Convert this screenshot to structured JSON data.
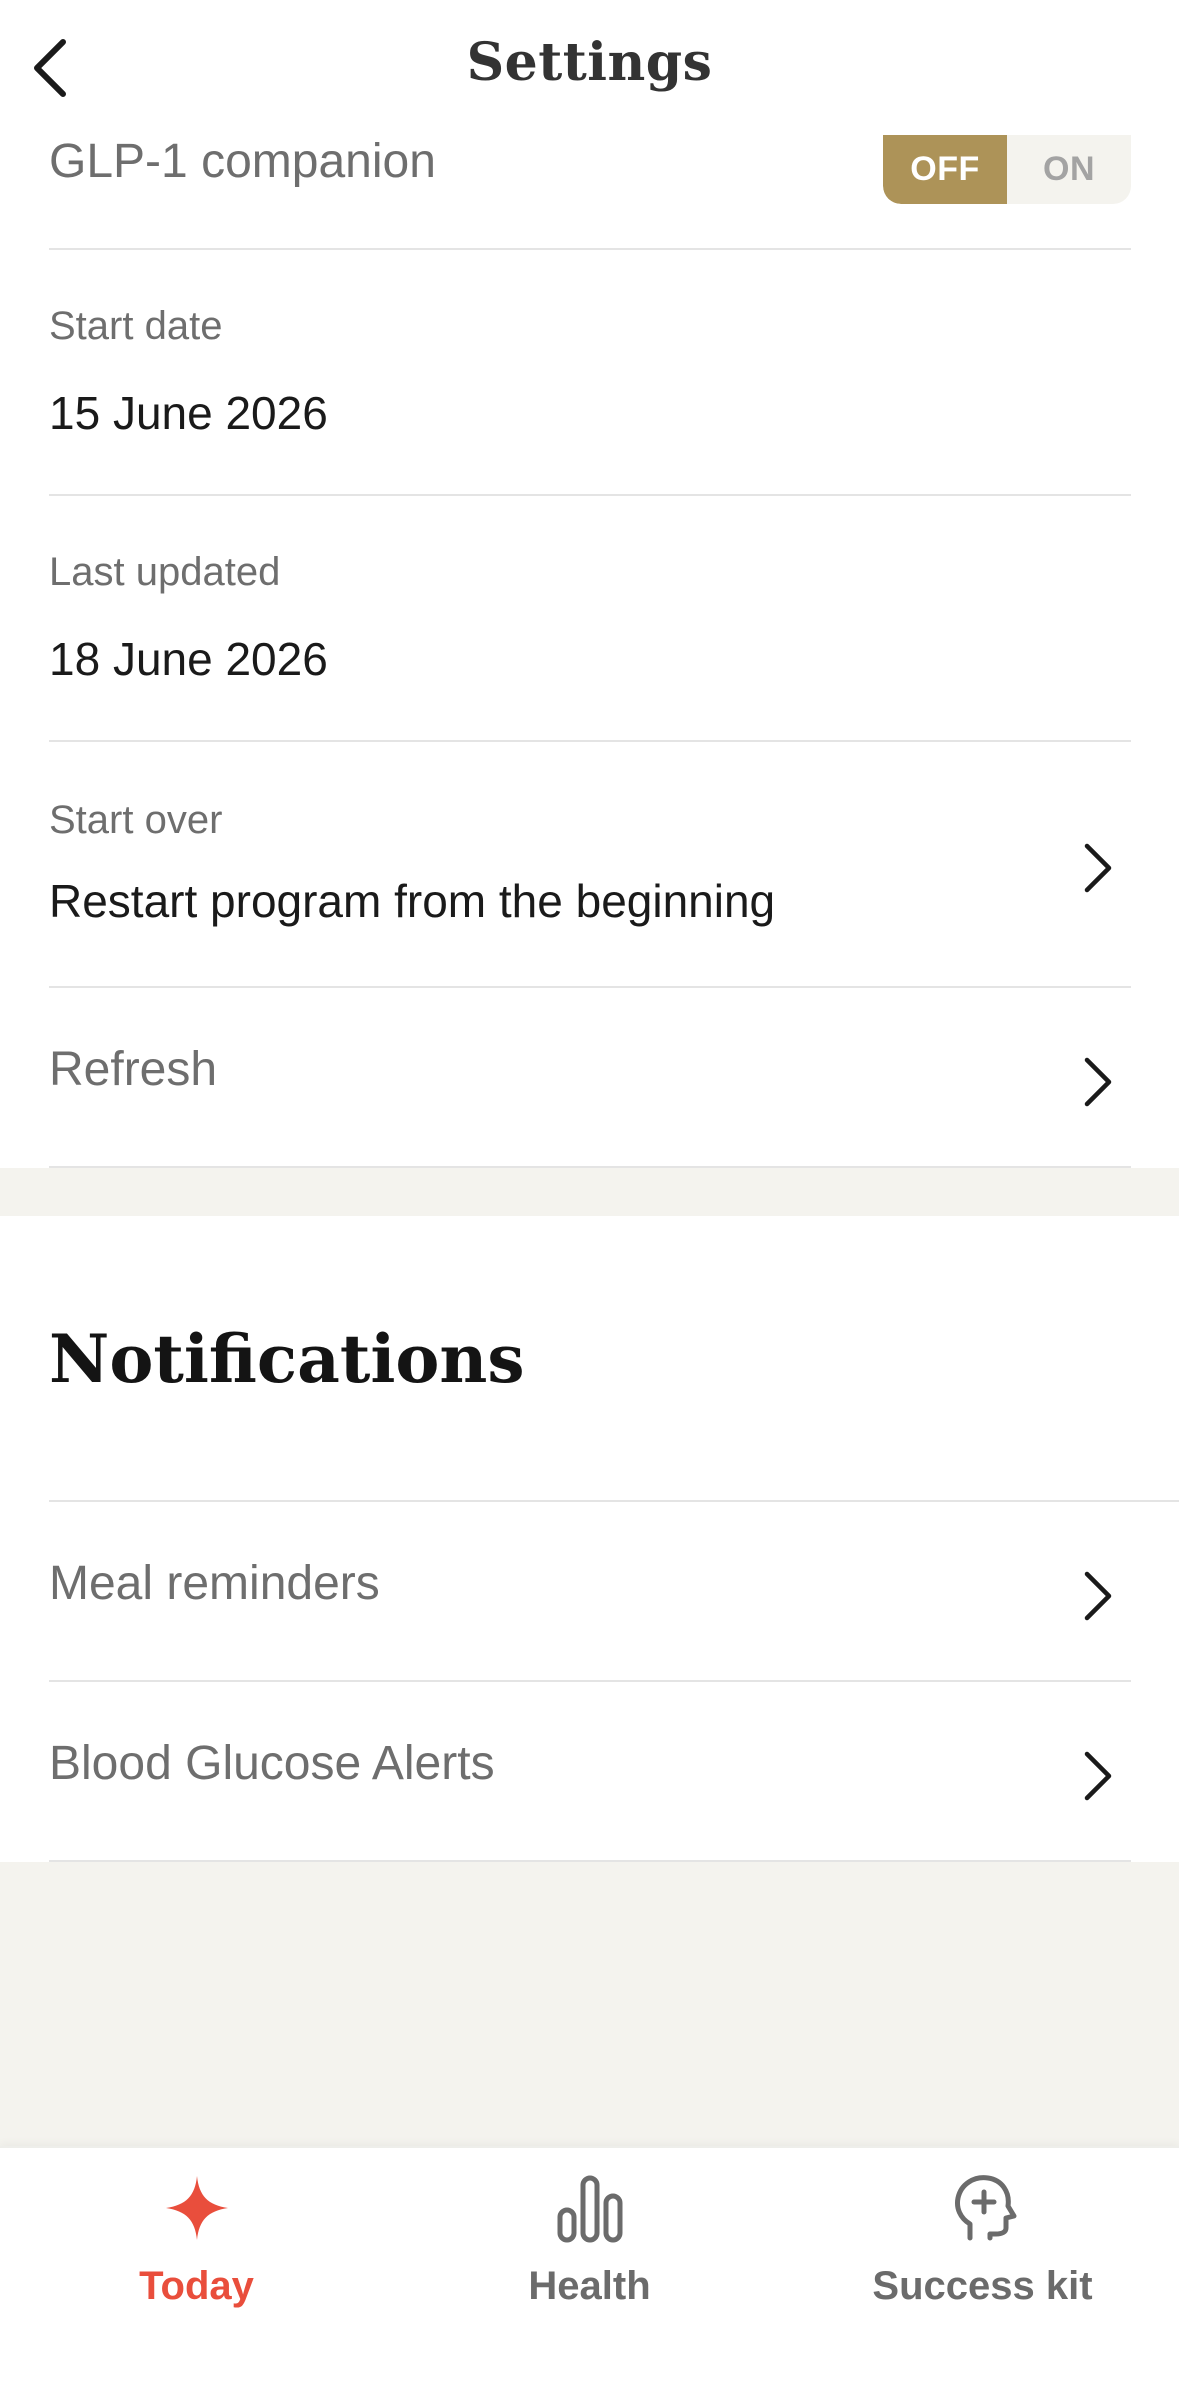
{
  "header": {
    "title": "Settings"
  },
  "glp": {
    "label": "GLP-1 companion",
    "toggle_off": "OFF",
    "toggle_on": "ON",
    "selected": "OFF"
  },
  "start_date": {
    "label": "Start date",
    "value": "15 June 2026"
  },
  "last_updated": {
    "label": "Last updated",
    "value": "18 June 2026"
  },
  "start_over": {
    "label": "Start over",
    "value": "Restart program from the beginning"
  },
  "refresh": {
    "label": "Refresh"
  },
  "notifications": {
    "title": "Notifications",
    "items": [
      {
        "label": "Meal reminders"
      },
      {
        "label": "Blood Glucose Alerts"
      }
    ]
  },
  "tabs": [
    {
      "label": "Today",
      "icon": "sparkle-icon",
      "active": true
    },
    {
      "label": "Health",
      "icon": "bar-chart-icon",
      "active": false
    },
    {
      "label": "Success kit",
      "icon": "head-plus-icon",
      "active": false
    }
  ],
  "colors": {
    "accent": "#ad9358",
    "active_tab": "#e94e3c",
    "inactive_tab": "#6b6b6b",
    "band": "#f4f3ee"
  }
}
